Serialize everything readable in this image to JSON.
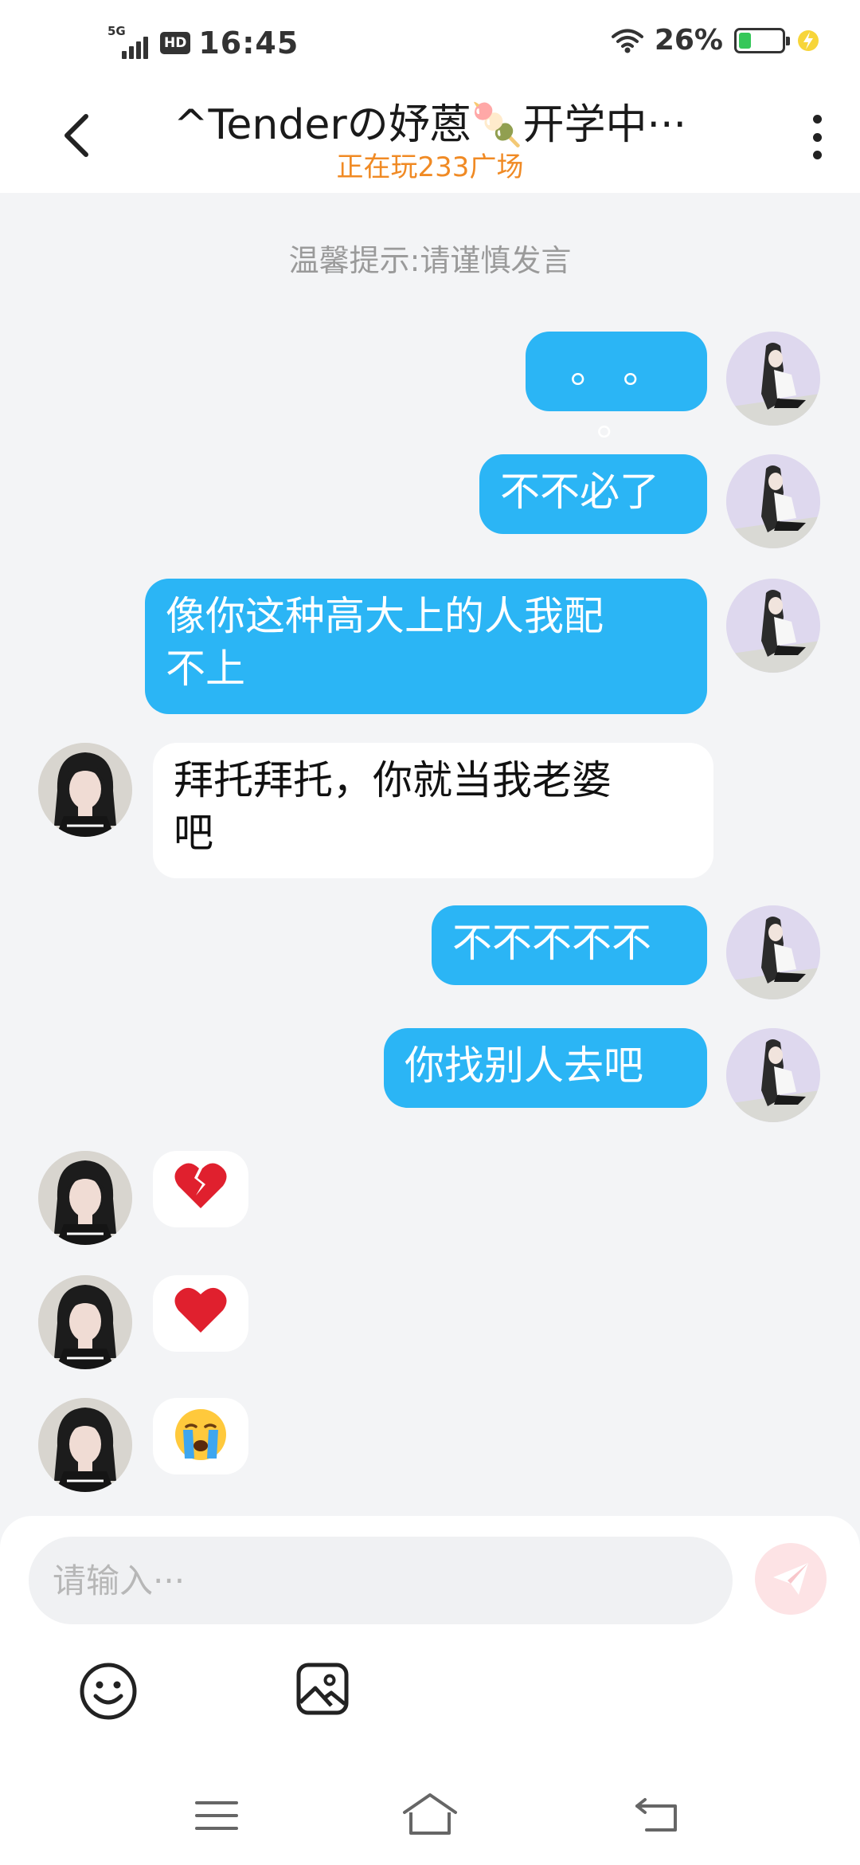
{
  "status_bar": {
    "network": "5G",
    "hd": "HD",
    "time": "16:45",
    "battery_percent": "26%",
    "battery_level": 0.26
  },
  "header": {
    "title": "^Tenderの妤蒽🍡开学中···",
    "subtitle": "正在玩233广场"
  },
  "chat": {
    "tip": "温馨提示:请谨慎发言",
    "messages": [
      {
        "sender": "me",
        "text": "。 。 。"
      },
      {
        "sender": "me",
        "text": "不不必了"
      },
      {
        "sender": "me",
        "line1": "像你这种高大上的人我配",
        "line2": "不上"
      },
      {
        "sender": "other",
        "line1": "拜托拜托，你就当我老婆",
        "line2": "吧"
      },
      {
        "sender": "me",
        "text": "不不不不不"
      },
      {
        "sender": "me",
        "text": "你找别人去吧"
      },
      {
        "sender": "other",
        "emoji": "💔",
        "icon": "broken-heart-icon"
      },
      {
        "sender": "other",
        "emoji": "❤",
        "icon": "red-heart-icon"
      },
      {
        "sender": "other",
        "emoji": "😭",
        "icon": "loudly-crying-face-icon"
      }
    ]
  },
  "input": {
    "placeholder": "请输入···"
  },
  "colors": {
    "my_bubble": "#2bb5f5",
    "their_bubble": "#ffffff",
    "background": "#f3f4f6",
    "subtitle": "#f08a24",
    "send_button": "#fde3e5"
  },
  "icons": {
    "back": "back-chevron-icon",
    "more": "more-vertical-icon",
    "send": "paper-plane-icon",
    "emoji": "smiley-face-icon",
    "image": "image-gallery-icon",
    "nav_menu": "menu-lines-icon",
    "nav_home": "home-icon",
    "nav_back": "return-arrow-icon"
  }
}
